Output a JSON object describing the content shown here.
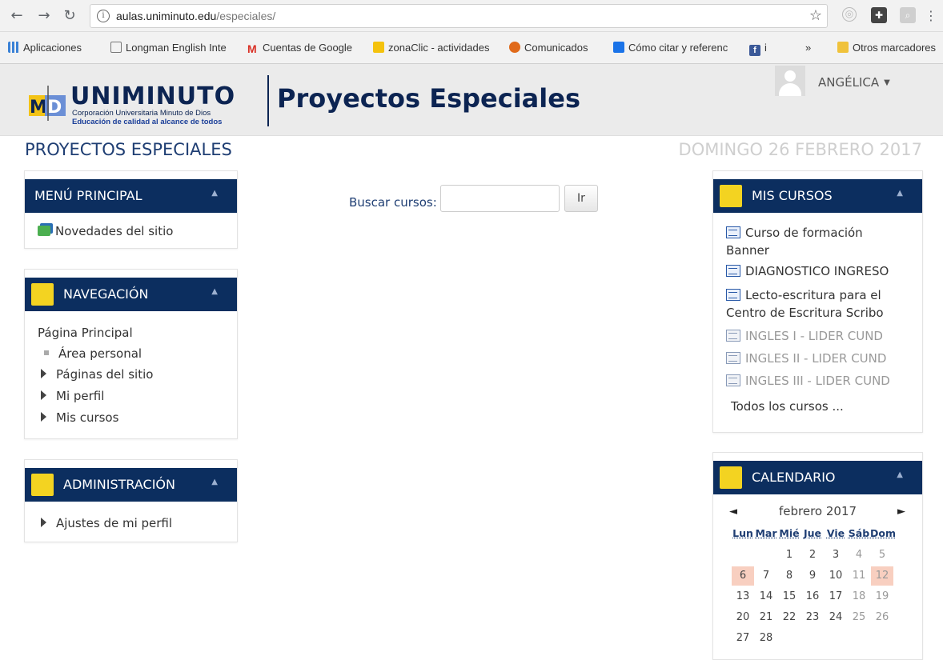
{
  "browser": {
    "url_host": "aulas.uniminuto.edu",
    "url_path": "/especiales/",
    "bookmarks": [
      {
        "label": "Aplicaciones",
        "color": "#3b82d6"
      },
      {
        "label": "Longman English Inte",
        "color": "#ffffff"
      },
      {
        "label": "Cuentas de Google",
        "color": "#d93025"
      },
      {
        "label": "zonaClic - actividades",
        "color": "#f4c20d"
      },
      {
        "label": "Comunicados",
        "color": "#e06a1b"
      },
      {
        "label": "Cómo citar y referenc",
        "color": "#1a73e8"
      },
      {
        "label": "i",
        "color": "#3b5998"
      },
      {
        "label": "»",
        "color": ""
      },
      {
        "label": "Otros marcadores",
        "color": "#f0c23b"
      }
    ]
  },
  "header": {
    "logo_name": "UNIMINUTO",
    "logo_sub1": "Corporación Universitaria Minuto de Dios",
    "logo_sub2": "Educación de calidad al alcance de todos",
    "site_title": "Proyectos Especiales",
    "user_name": "ANGÉLICA",
    "user_caret": "▼"
  },
  "page": {
    "heading": "PROYECTOS ESPECIALES",
    "date": "DOMINGO 26 FEBRERO 2017"
  },
  "menu_principal": {
    "title": "MENÚ PRINCIPAL",
    "items": [
      "Novedades del sitio"
    ]
  },
  "navegacion": {
    "title": "NAVEGACIÓN",
    "root": "Página Principal",
    "items": [
      "Área personal",
      "Páginas del sitio",
      "Mi perfil",
      "Mis cursos"
    ]
  },
  "administracion": {
    "title": "ADMINISTRACIÓN",
    "items": [
      "Ajustes de mi perfil"
    ]
  },
  "search": {
    "label": "Buscar cursos:",
    "value": "",
    "button": "Ir"
  },
  "mis_cursos": {
    "title": "MIS CURSOS",
    "courses": [
      {
        "line1": "Curso de formación",
        "line2": "Banner",
        "muted": false
      },
      {
        "line1": "DIAGNOSTICO INGRESO",
        "line2": "",
        "muted": false
      },
      {
        "line1": "Lecto-escritura para el",
        "line2": "Centro de Escritura Scribo",
        "muted": false
      },
      {
        "line1": "INGLES I - LIDER CUND",
        "line2": "",
        "muted": true
      },
      {
        "line1": "INGLES II - LIDER CUND",
        "line2": "",
        "muted": true
      },
      {
        "line1": "INGLES III - LIDER CUND",
        "line2": "",
        "muted": true
      }
    ],
    "all_link": "Todos los cursos ..."
  },
  "calendario": {
    "title": "CALENDARIO",
    "month": "febrero 2017",
    "prev": "◄",
    "next": "►",
    "dow": [
      "Lun",
      "Mar",
      "Mié",
      "Jue",
      "Vie",
      "Sáb",
      "Dom"
    ],
    "weeks": [
      [
        "",
        "",
        "1",
        "2",
        "3",
        "4",
        "5"
      ],
      [
        "6",
        "7",
        "8",
        "9",
        "10",
        "11",
        "12"
      ],
      [
        "13",
        "14",
        "15",
        "16",
        "17",
        "18",
        "19"
      ],
      [
        "20",
        "21",
        "22",
        "23",
        "24",
        "25",
        "26"
      ],
      [
        "27",
        "28",
        "",
        "",
        "",
        "",
        ""
      ]
    ],
    "highlight": [
      "6",
      "12"
    ],
    "colors": {
      "highlight": "#f8cfc0",
      "header_bg": "#0c2e5f",
      "badge": "#f3d321"
    }
  }
}
